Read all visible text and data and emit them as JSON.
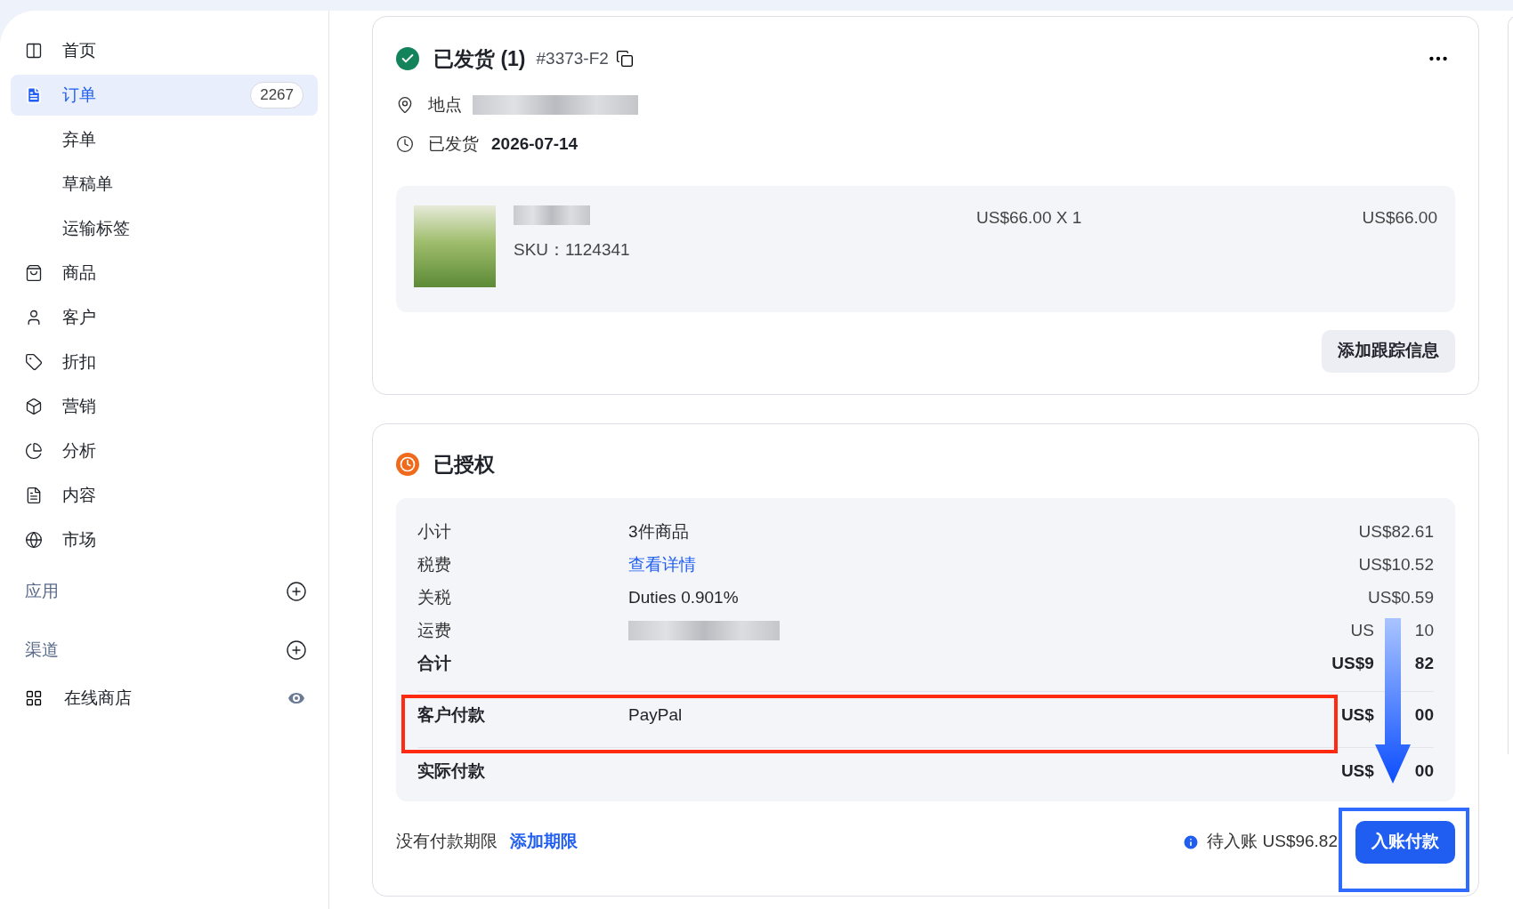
{
  "sidebar": {
    "items": [
      {
        "label": "首页",
        "kind": "main",
        "selected": false
      },
      {
        "label": "订单",
        "kind": "main",
        "selected": true,
        "badge": "2267"
      },
      {
        "label": "弃单",
        "kind": "sub",
        "selected": false
      },
      {
        "label": "草稿单",
        "kind": "sub",
        "selected": false
      },
      {
        "label": "运输标签",
        "kind": "sub",
        "selected": false
      },
      {
        "label": "商品",
        "kind": "main",
        "selected": false
      },
      {
        "label": "客户",
        "kind": "main",
        "selected": false
      },
      {
        "label": "折扣",
        "kind": "main",
        "selected": false
      },
      {
        "label": "营销",
        "kind": "main",
        "selected": false
      },
      {
        "label": "分析",
        "kind": "main",
        "selected": false
      },
      {
        "label": "内容",
        "kind": "main",
        "selected": false
      },
      {
        "label": "市场",
        "kind": "main",
        "selected": false
      }
    ],
    "sections": [
      {
        "label": "应用"
      },
      {
        "label": "渠道"
      }
    ],
    "channel": {
      "label": "在线商店"
    }
  },
  "shipment": {
    "status": "已发货 (1)",
    "order_ref": "#3373-F2",
    "location_label": "地点",
    "shipped_label": "已发货",
    "shipped_date": "2026-07-14",
    "line_item": {
      "sku": "SKU：1124341",
      "unit_price": "US$66.00 X 1",
      "total": "US$66.00"
    },
    "button": "添加跟踪信息"
  },
  "payment": {
    "status": "已授权",
    "rows": [
      {
        "kind": "line",
        "label": "小计",
        "detail": {
          "kind": "text",
          "text": "3件商品"
        },
        "amount": [
          "US$82.61"
        ],
        "divider": false
      },
      {
        "kind": "line",
        "label": "税费",
        "detail": {
          "kind": "link",
          "text": "查看详情"
        },
        "amount": [
          "US$10.52"
        ],
        "divider": false
      },
      {
        "kind": "line",
        "label": "关税",
        "detail": {
          "kind": "text",
          "text": "Duties 0.901%"
        },
        "amount": [
          "US$0.59"
        ],
        "divider": false
      },
      {
        "kind": "line",
        "label": "运费",
        "detail": {
          "kind": "blurred"
        },
        "amount": [
          "US",
          "10"
        ],
        "divider": false
      },
      {
        "kind": "total",
        "label": "合计",
        "amount": [
          "US$9",
          "82"
        ],
        "divider": false
      },
      {
        "kind": "total",
        "label": "客户付款",
        "detail": {
          "kind": "text",
          "text": "PayPal"
        },
        "amount": [
          "US$",
          "00"
        ],
        "divider": true
      },
      {
        "kind": "total",
        "label": "实际付款",
        "amount": [
          "US$",
          "00"
        ],
        "divider": true
      }
    ],
    "footer": {
      "note": "没有付款期限",
      "link": "添加期限",
      "pending": "待入账 US$96.82",
      "button": "入账付款"
    }
  }
}
